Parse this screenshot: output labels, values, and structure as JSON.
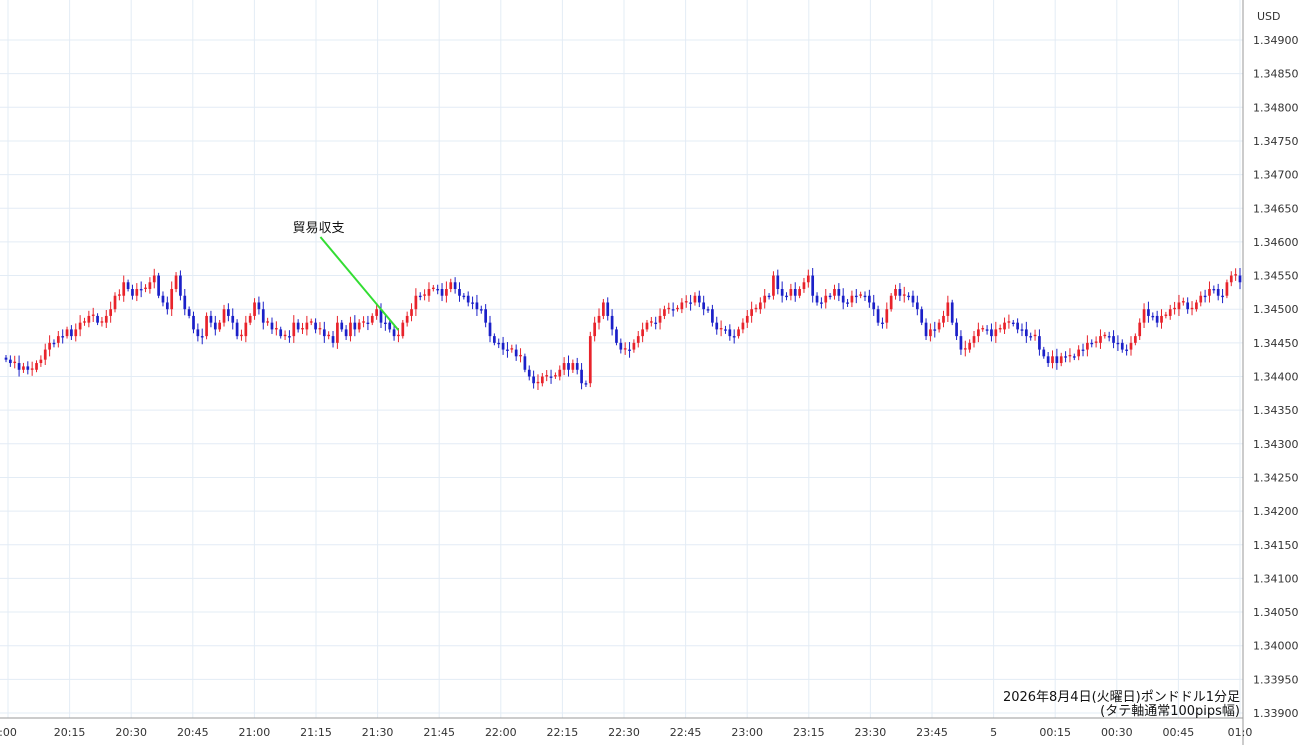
{
  "chart_data": {
    "type": "candlestick",
    "y_unit": "USD",
    "ylim": [
      1.339,
      1.3492
    ],
    "y_ticks": [
      "1.34900",
      "1.34850",
      "1.34800",
      "1.34750",
      "1.34700",
      "1.34650",
      "1.34600",
      "1.34550",
      "1.34500",
      "1.34450",
      "1.34400",
      "1.34350",
      "1.34300",
      "1.34250",
      "1.34200",
      "1.34150",
      "1.34100",
      "1.34050",
      "1.34000",
      "1.33950",
      "1.33900"
    ],
    "x_ticks": [
      ":00",
      "20:15",
      "20:30",
      "20:45",
      "21:00",
      "21:15",
      "21:30",
      "21:45",
      "22:00",
      "22:15",
      "22:30",
      "22:45",
      "23:00",
      "23:15",
      "23:30",
      "23:45",
      "5",
      "00:15",
      "00:30",
      "00:45",
      "01:0"
    ],
    "grid": true,
    "up_color": "#e8232b",
    "down_color": "#1b20c8",
    "annotation": {
      "label": "貿易収支",
      "time_index": 90,
      "line_color": "#33dd33"
    },
    "caption": [
      "2026年8月4日(火曜日)ポンドドル1分足",
      "(タテ軸通常100pips幅)"
    ],
    "close_series": [
      1.34425,
      1.3442,
      1.3442,
      1.3441,
      1.34415,
      1.3441,
      1.3441,
      1.3442,
      1.34425,
      1.3444,
      1.3445,
      1.3445,
      1.3446,
      1.3446,
      1.3447,
      1.3446,
      1.3447,
      1.3448,
      1.3448,
      1.3449,
      1.3449,
      1.3448,
      1.3448,
      1.3449,
      1.345,
      1.3452,
      1.3452,
      1.3454,
      1.3453,
      1.3452,
      1.3453,
      1.3453,
      1.3453,
      1.3454,
      1.3455,
      1.3452,
      1.3451,
      1.345,
      1.3453,
      1.3455,
      1.3452,
      1.345,
      1.3449,
      1.3447,
      1.3446,
      1.3446,
      1.3449,
      1.3448,
      1.3447,
      1.3448,
      1.345,
      1.3449,
      1.3448,
      1.3446,
      1.3446,
      1.3448,
      1.3449,
      1.3451,
      1.345,
      1.3448,
      1.3448,
      1.3447,
      1.3447,
      1.3446,
      1.3446,
      1.3446,
      1.3448,
      1.3447,
      1.3447,
      1.3448,
      1.3448,
      1.3447,
      1.3447,
      1.3446,
      1.3446,
      1.3445,
      1.3448,
      1.3447,
      1.3446,
      1.3448,
      1.3447,
      1.3448,
      1.3448,
      1.3448,
      1.3449,
      1.345,
      1.3448,
      1.3448,
      1.3447,
      1.3446,
      1.3446,
      1.3448,
      1.3449,
      1.345,
      1.3452,
      1.3452,
      1.3452,
      1.3453,
      1.3453,
      1.3453,
      1.3452,
      1.3453,
      1.3454,
      1.3453,
      1.3452,
      1.3452,
      1.3451,
      1.3451,
      1.345,
      1.345,
      1.3448,
      1.3446,
      1.3445,
      1.3445,
      1.3444,
      1.3444,
      1.3444,
      1.3443,
      1.3443,
      1.3441,
      1.344,
      1.3439,
      1.3439,
      1.344,
      1.344,
      1.344,
      1.344,
      1.3441,
      1.3442,
      1.3441,
      1.3442,
      1.3441,
      1.3439,
      1.3439,
      1.3446,
      1.3448,
      1.3449,
      1.3451,
      1.3449,
      1.3447,
      1.3445,
      1.3444,
      1.3444,
      1.3444,
      1.3445,
      1.3446,
      1.3447,
      1.3448,
      1.3448,
      1.3448,
      1.3449,
      1.345,
      1.345,
      1.345,
      1.345,
      1.3451,
      1.3451,
      1.3451,
      1.3452,
      1.3451,
      1.345,
      1.345,
      1.3448,
      1.3447,
      1.3447,
      1.3447,
      1.3446,
      1.3446,
      1.3447,
      1.3448,
      1.3449,
      1.345,
      1.345,
      1.3451,
      1.3452,
      1.3452,
      1.3455,
      1.3453,
      1.3452,
      1.3452,
      1.3453,
      1.3452,
      1.3453,
      1.3454,
      1.3455,
      1.3452,
      1.3451,
      1.3451,
      1.3452,
      1.3452,
      1.3453,
      1.3452,
      1.3451,
      1.3451,
      1.3452,
      1.3452,
      1.3452,
      1.3452,
      1.3451,
      1.345,
      1.3448,
      1.3448,
      1.345,
      1.3452,
      1.3453,
      1.3452,
      1.3452,
      1.3452,
      1.3451,
      1.345,
      1.3448,
      1.3446,
      1.3447,
      1.3447,
      1.3448,
      1.3449,
      1.3451,
      1.3448,
      1.3446,
      1.3444,
      1.3444,
      1.3445,
      1.3446,
      1.3447,
      1.3447,
      1.3447,
      1.3446,
      1.3447,
      1.3447,
      1.3448,
      1.3448,
      1.3448,
      1.3447,
      1.3447,
      1.3446,
      1.3446,
      1.3446,
      1.3444,
      1.3443,
      1.3442,
      1.3443,
      1.3442,
      1.3443,
      1.3443,
      1.3443,
      1.3443,
      1.3444,
      1.3444,
      1.3445,
      1.3445,
      1.3445,
      1.3446,
      1.3446,
      1.3446,
      1.3445,
      1.3445,
      1.3444,
      1.3444,
      1.3445,
      1.3446,
      1.3448,
      1.345,
      1.3449,
      1.3449,
      1.3448,
      1.3449,
      1.3449,
      1.345,
      1.345,
      1.3451,
      1.3451,
      1.345,
      1.345,
      1.3451,
      1.3452,
      1.3452,
      1.3453,
      1.3453,
      1.3452,
      1.3452,
      1.3454,
      1.3455,
      1.3455,
      1.3454
    ]
  }
}
